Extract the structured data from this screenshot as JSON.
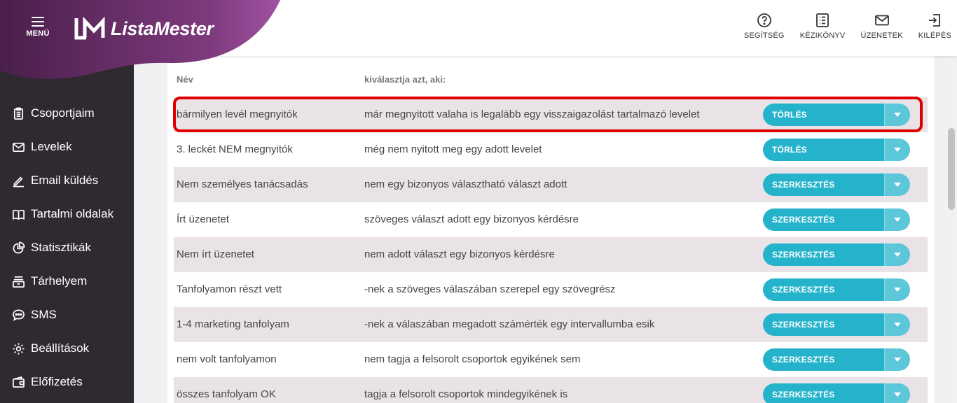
{
  "header": {
    "menu_label": "MENÜ",
    "logo_text": "ListaMester",
    "actions": [
      {
        "label": "SEGÍTSÉG",
        "icon": "help-icon"
      },
      {
        "label": "KÉZIKÖNYV",
        "icon": "manual-icon"
      },
      {
        "label": "ÜZENETEK",
        "icon": "mail-icon"
      },
      {
        "label": "KILÉPÉS",
        "icon": "logout-icon"
      }
    ]
  },
  "sidebar": {
    "items": [
      {
        "label": "Csoportjaim",
        "icon": "clipboard-icon"
      },
      {
        "label": "Levelek",
        "icon": "envelope-icon"
      },
      {
        "label": "Email küldés",
        "icon": "pencil-icon"
      },
      {
        "label": "Tartalmi oldalak",
        "icon": "book-icon"
      },
      {
        "label": "Statisztikák",
        "icon": "pie-chart-icon"
      },
      {
        "label": "Tárhelyem",
        "icon": "storage-icon"
      },
      {
        "label": "SMS",
        "icon": "chat-icon"
      },
      {
        "label": "Beállítások",
        "icon": "gear-icon"
      },
      {
        "label": "Előfizetés",
        "icon": "wallet-icon"
      }
    ]
  },
  "table": {
    "headers": {
      "name": "Név",
      "condition": "kiválasztja azt, aki:"
    },
    "rows": [
      {
        "name": "bármilyen levél megnyitók",
        "condition": "már megnyitott valaha is legalább egy visszaigazolást tartalmazó levelet",
        "action": "TÖRLÉS"
      },
      {
        "name": "3. leckét NEM megnyitók",
        "condition": "még nem nyitott meg egy adott levelet",
        "action": "TÖRLÉS"
      },
      {
        "name": "Nem személyes tanácsadás",
        "condition": "nem egy bizonyos választható választ adott",
        "action": "SZERKESZTÉS"
      },
      {
        "name": "Írt üzenetet",
        "condition": "szöveges választ adott egy bizonyos kérdésre",
        "action": "SZERKESZTÉS"
      },
      {
        "name": "Nem írt üzenetet",
        "condition": "nem adott választ egy bizonyos kérdésre",
        "action": "SZERKESZTÉS"
      },
      {
        "name": "Tanfolyamon részt vett",
        "condition": "-nek a szöveges válaszában szerepel egy szövegrész",
        "action": "SZERKESZTÉS"
      },
      {
        "name": "1-4 marketing tanfolyam",
        "condition": "-nek a válaszában megadott számérték egy intervallumba esik",
        "action": "SZERKESZTÉS"
      },
      {
        "name": "nem volt tanfolyamon",
        "condition": "nem tagja a felsorolt csoportok egyikének sem",
        "action": "SZERKESZTÉS"
      },
      {
        "name": "összes tanfolyam OK",
        "condition": "tagja a felsorolt csoportok mindegyikének is",
        "action": "SZERKESZTÉS"
      }
    ]
  },
  "colors": {
    "sidebar_bg": "#2f2a30",
    "brand_gradient_start": "#4a1f4a",
    "brand_gradient_end": "#9b4a9b",
    "button_primary": "#25b3cc",
    "button_drop": "#5cc7d9",
    "row_alt": "#e9e3e8",
    "highlight": "#e00000"
  }
}
